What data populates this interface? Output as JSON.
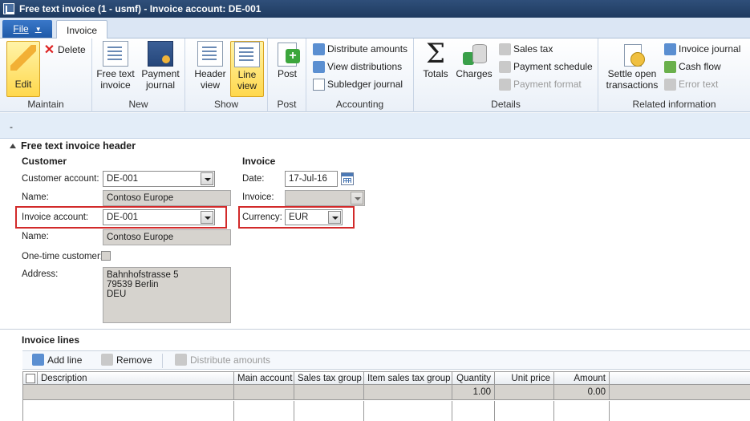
{
  "window": {
    "title": "Free text invoice (1 - usmf) - Invoice account: DE-001"
  },
  "tabs": {
    "file": "File",
    "invoice": "Invoice"
  },
  "ribbon": {
    "maintain": {
      "label": "Maintain",
      "edit": "Edit",
      "delete": "Delete"
    },
    "new": {
      "label": "New",
      "free_text_invoice": "Free text\ninvoice",
      "payment_journal": "Payment\njournal"
    },
    "show": {
      "label": "Show",
      "header_view": "Header\nview",
      "line_view": "Line\nview"
    },
    "post": {
      "label": "Post",
      "post": "Post"
    },
    "accounting": {
      "label": "Accounting",
      "distribute_amounts": "Distribute amounts",
      "view_distributions": "View distributions",
      "subledger_journal": "Subledger journal"
    },
    "details": {
      "label": "Details",
      "totals": "Totals",
      "charges": "Charges",
      "sales_tax": "Sales tax",
      "payment_schedule": "Payment schedule",
      "payment_format": "Payment format"
    },
    "related": {
      "label": "Related information",
      "settle_open": "Settle open\ntransactions",
      "invoice_journal": "Invoice journal",
      "cash_flow": "Cash flow",
      "error_text": "Error text"
    }
  },
  "collapse_bar": {
    "text": "-"
  },
  "header": {
    "title": "Free text invoice header",
    "customer": {
      "title": "Customer",
      "customer_account_label": "Customer account:",
      "customer_account": "DE-001",
      "name_label": "Name:",
      "name": "Contoso Europe",
      "invoice_account_label": "Invoice account:",
      "invoice_account": "DE-001",
      "name2_label": "Name:",
      "name2": "Contoso Europe",
      "one_time_label": "One-time customer:",
      "address_label": "Address:",
      "address": "Bahnhofstrasse 5\n79539 Berlin\nDEU"
    },
    "invoice": {
      "title": "Invoice",
      "date_label": "Date:",
      "date": "17-Jul-16",
      "invoice_label": "Invoice:",
      "invoice": "",
      "currency_label": "Currency:",
      "currency": "EUR"
    }
  },
  "lines": {
    "title": "Invoice lines",
    "add_line": "Add line",
    "remove": "Remove",
    "distribute_amounts": "Distribute amounts",
    "columns": [
      "Description",
      "Main account",
      "Sales tax group",
      "Item sales tax group",
      "Quantity",
      "Unit price",
      "Amount"
    ],
    "rows": [
      {
        "description": "",
        "main_account": "",
        "sales_tax_group": "",
        "item_sales_tax_group": "",
        "quantity": "1.00",
        "unit_price": "",
        "amount": "0.00"
      }
    ]
  }
}
